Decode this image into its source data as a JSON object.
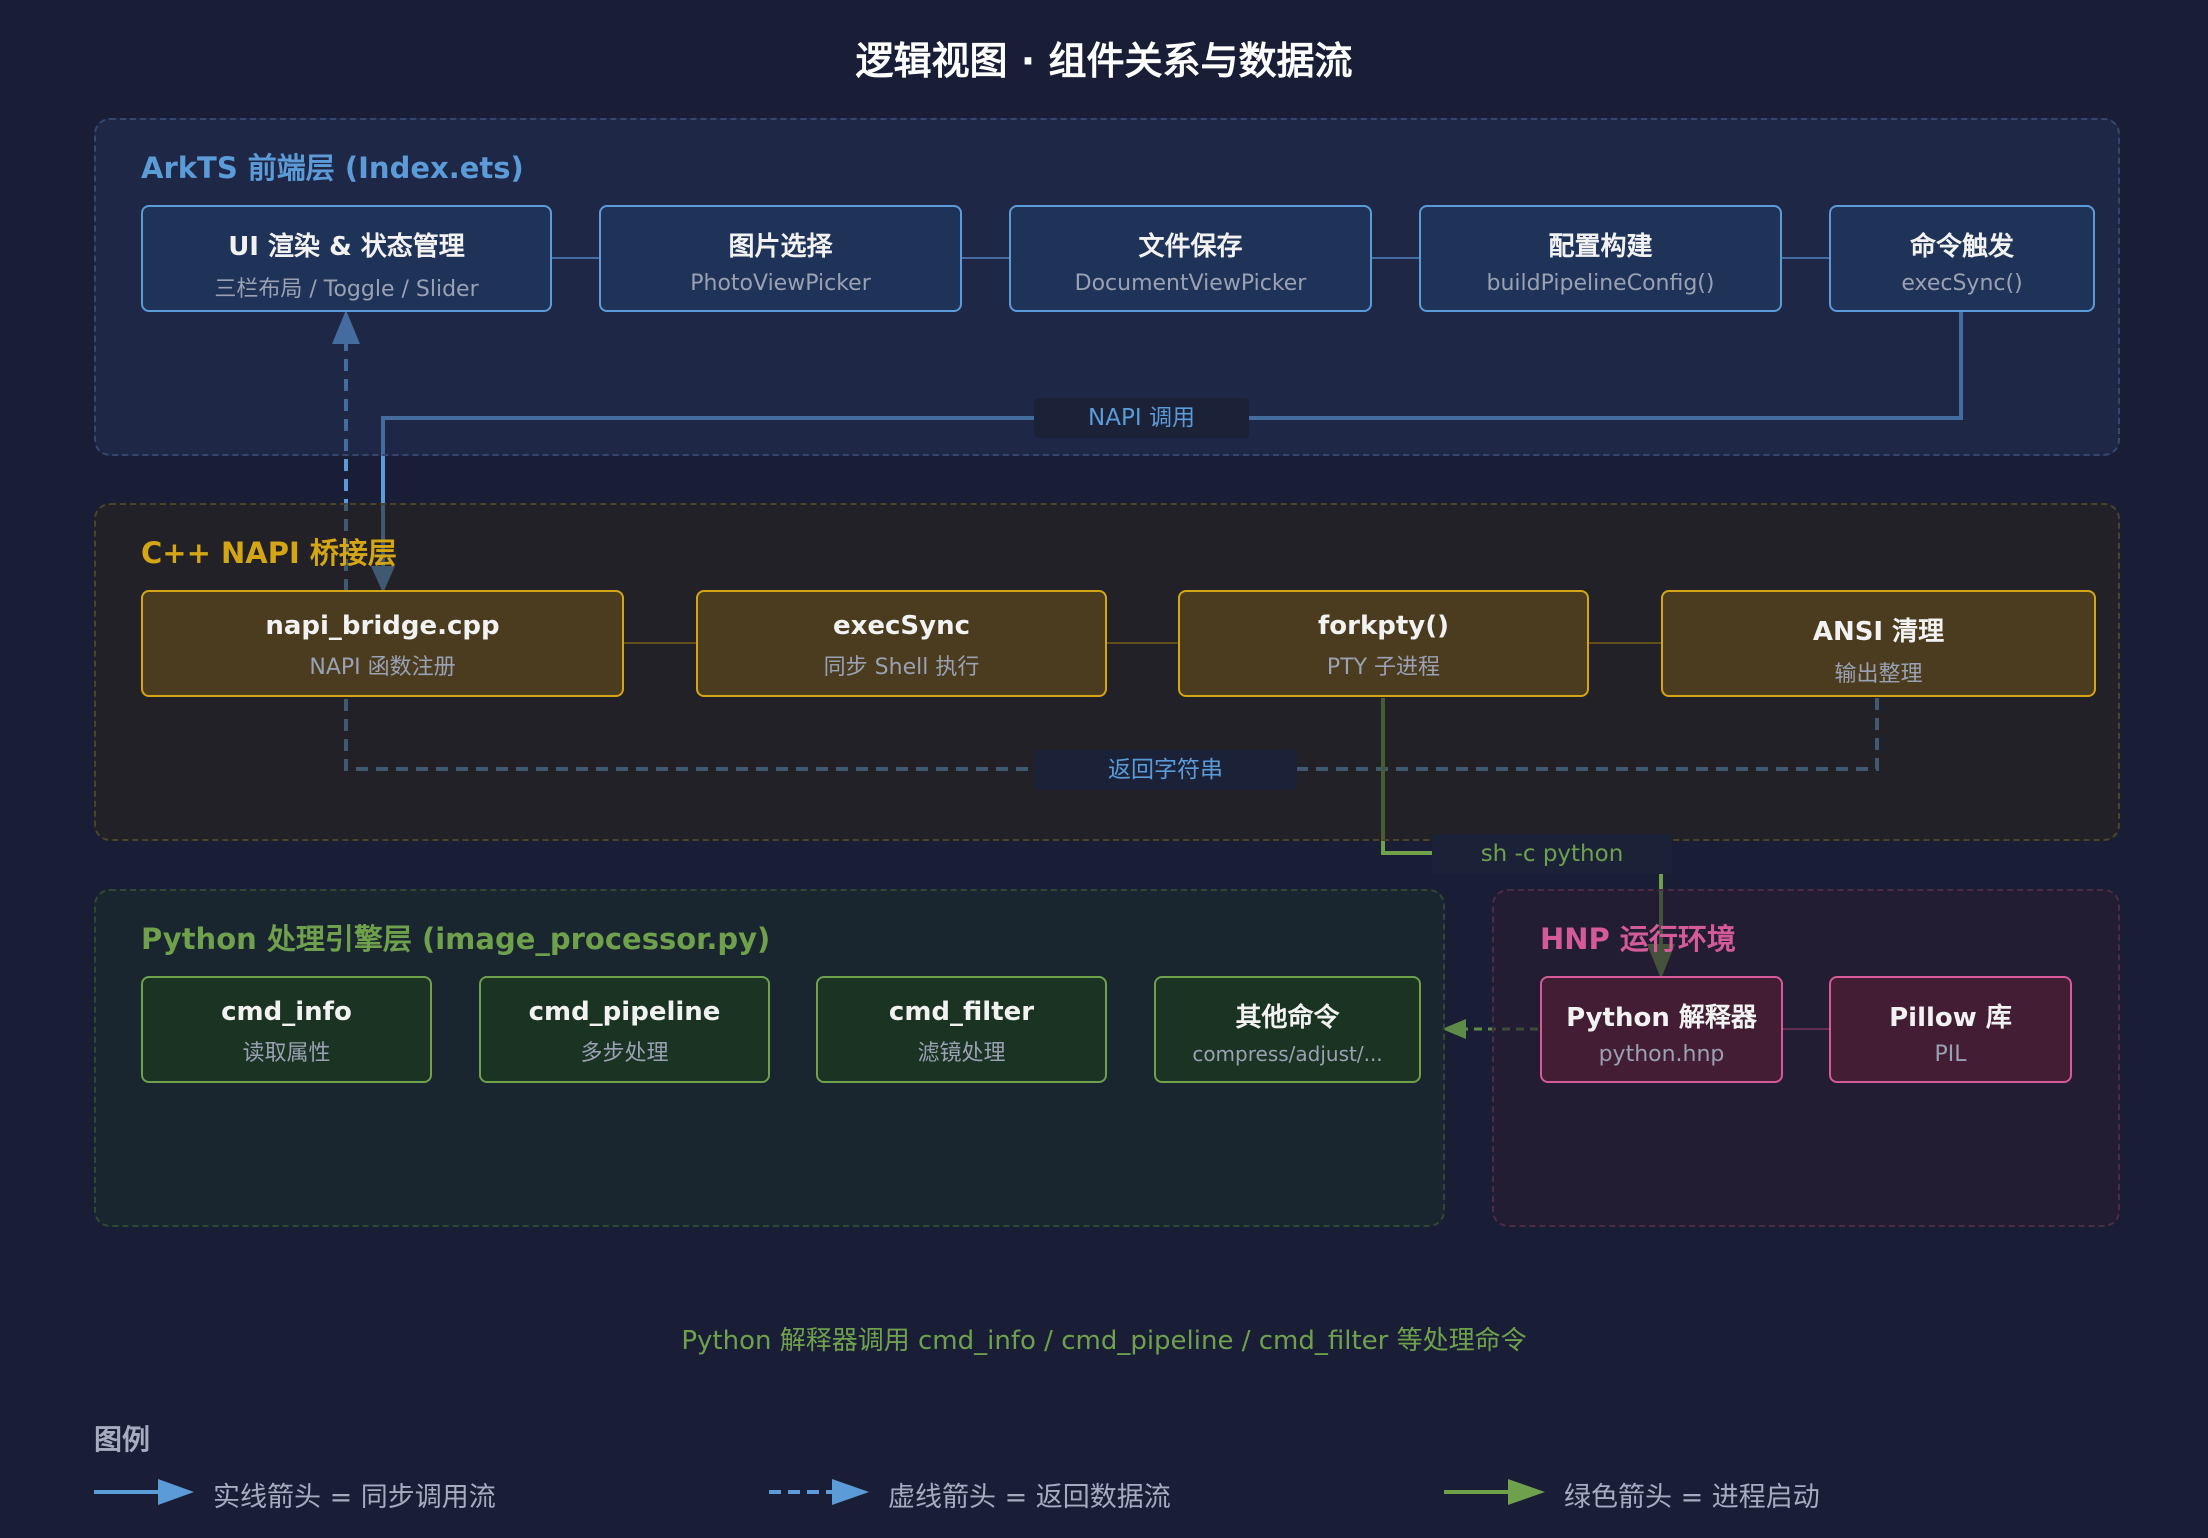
{
  "title": "逻辑视图 · 组件关系与数据流",
  "colors": {
    "background": "#191e36",
    "arkts": "#5b9bd8",
    "cpp": "#d4a514",
    "python": "#6fa04c",
    "hnp": "#d45a9a"
  },
  "layers": {
    "arkts": {
      "title": "ArkTS 前端层 (Index.ets)",
      "nodes": [
        {
          "title": "UI 渲染 & 状态管理",
          "sub": "三栏布局 / Toggle / Slider"
        },
        {
          "title": "图片选择",
          "sub": "PhotoViewPicker"
        },
        {
          "title": "文件保存",
          "sub": "DocumentViewPicker"
        },
        {
          "title": "配置构建",
          "sub": "buildPipelineConfig()"
        },
        {
          "title": "命令触发",
          "sub": "execSync()"
        }
      ]
    },
    "cpp": {
      "title": "C++ NAPI 桥接层",
      "nodes": [
        {
          "title": "napi_bridge.cpp",
          "sub": "NAPI 函数注册"
        },
        {
          "title": "execSync",
          "sub": "同步 Shell 执行"
        },
        {
          "title": "forkpty()",
          "sub": "PTY 子进程"
        },
        {
          "title": "ANSI 清理",
          "sub": "输出整理"
        }
      ]
    },
    "python": {
      "title": "Python 处理引擎层 (image_processor.py)",
      "nodes": [
        {
          "title": "cmd_info",
          "sub": "读取属性"
        },
        {
          "title": "cmd_pipeline",
          "sub": "多步处理"
        },
        {
          "title": "cmd_filter",
          "sub": "滤镜处理"
        },
        {
          "title": "其他命令",
          "sub": "compress/adjust/..."
        }
      ]
    },
    "hnp": {
      "title": "HNP 运行环境",
      "nodes": [
        {
          "title": "Python 解释器",
          "sub": "python.hnp"
        },
        {
          "title": "Pillow 库",
          "sub": "PIL"
        }
      ]
    }
  },
  "edges": {
    "napi_call": "NAPI 调用",
    "return_string": "返回字符串",
    "sh_python": "sh -c python"
  },
  "footnote": "Python 解释器调用 cmd_info / cmd_pipeline / cmd_filter 等处理命令",
  "legend": {
    "title": "图例",
    "items": [
      {
        "label": "实线箭头 = 同步调用流"
      },
      {
        "label": "虚线箭头 = 返回数据流"
      },
      {
        "label": "绿色箭头 = 进程启动"
      }
    ]
  }
}
